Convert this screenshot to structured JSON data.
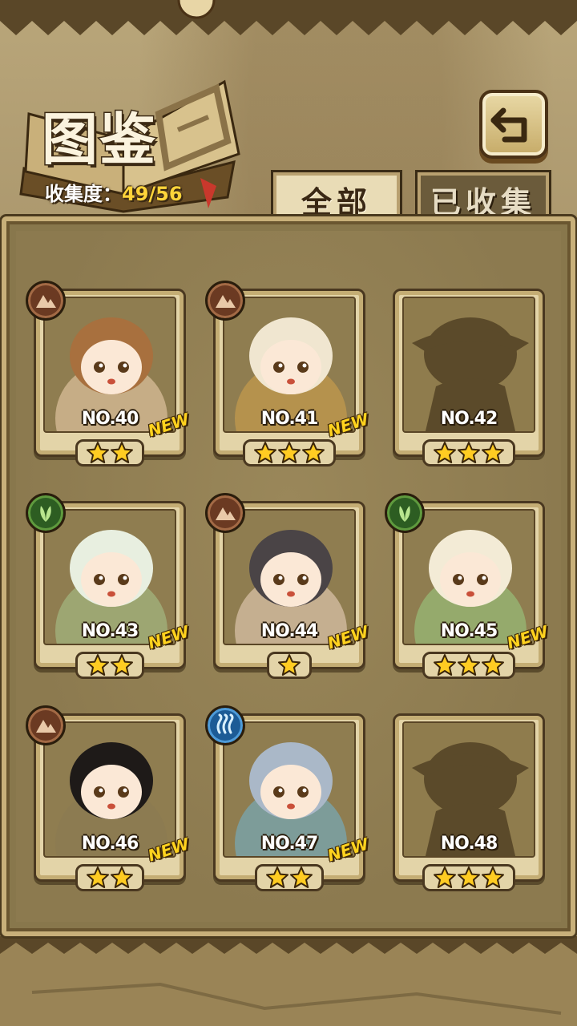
{
  "header": {
    "title": "图鉴",
    "progress_label": "收集度：",
    "progress_value": "49/56"
  },
  "tabs": [
    {
      "label": "全部",
      "active": true
    },
    {
      "label": "已收集",
      "active": false
    }
  ],
  "cards": [
    {
      "no": "NO.40",
      "stars": 2,
      "new": "NEW",
      "element": "earth-icon",
      "unlocked": true
    },
    {
      "no": "NO.41",
      "stars": 3,
      "new": "NEW",
      "element": "earth-icon",
      "unlocked": true
    },
    {
      "no": "NO.42",
      "stars": 3,
      "new": "",
      "element": "",
      "unlocked": false
    },
    {
      "no": "NO.43",
      "stars": 2,
      "new": "NEW",
      "element": "leaf-icon",
      "unlocked": true
    },
    {
      "no": "NO.44",
      "stars": 1,
      "new": "NEW",
      "element": "earth-icon",
      "unlocked": true
    },
    {
      "no": "NO.45",
      "stars": 3,
      "new": "NEW",
      "element": "leaf-icon",
      "unlocked": true
    },
    {
      "no": "NO.46",
      "stars": 2,
      "new": "NEW",
      "element": "earth-icon",
      "unlocked": true
    },
    {
      "no": "NO.47",
      "stars": 2,
      "new": "NEW",
      "element": "water-icon",
      "unlocked": true
    },
    {
      "no": "NO.48",
      "stars": 3,
      "new": "",
      "element": "",
      "unlocked": false
    }
  ],
  "colors": {
    "star": "#ffcc22",
    "new_text": "#ffd21e",
    "progress_value": "#ffd43a"
  }
}
